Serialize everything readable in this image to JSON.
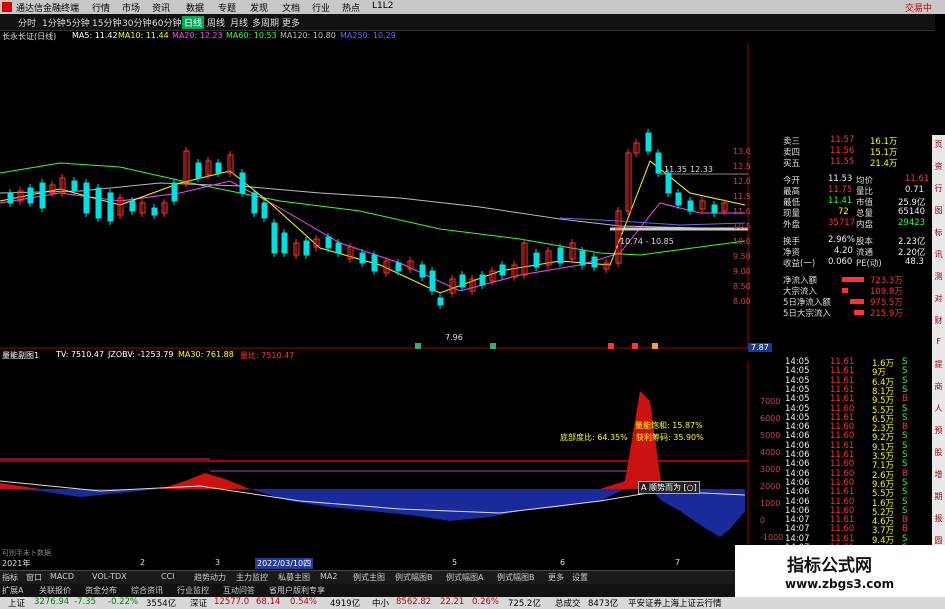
{
  "titlebar": {
    "app_name": "通达信金融终端",
    "menus": [
      "行情",
      "市场",
      "资讯",
      "数据",
      "专题",
      "发现",
      "文档",
      "行业",
      "热点",
      "L1L2"
    ],
    "right_text": "交易中"
  },
  "toolbar": {
    "periods": [
      "分时",
      "1分钟",
      "5分钟",
      "15分钟",
      "30分钟",
      "60分钟",
      "日线",
      "周线",
      "月线",
      "多周期",
      "更多"
    ],
    "active_period": "日线"
  },
  "ma_legend": {
    "stock": "长永长证(日线)",
    "items": [
      {
        "label": "MA5: 11.42",
        "color": "#ffffff"
      },
      {
        "label": "MA10: 11.44",
        "color": "#ffff00"
      },
      {
        "label": "MA20: 12.23",
        "color": "#ff44ff"
      },
      {
        "label": "MA60: 10.53",
        "color": "#33ff33"
      },
      {
        "label": "MA120: 10.80",
        "color": "#bbbbbb"
      },
      {
        "label": "MA250: 10.29",
        "color": "#6666ff"
      }
    ]
  },
  "price_axis": [
    "13.00",
    "12.50",
    "12.00",
    "11.50",
    "11.00",
    "10.50",
    "10.00",
    "9.50",
    "9.00",
    "8.50",
    "8.00"
  ],
  "annotations": {
    "high": "12.33",
    "low": "7.96",
    "mid_range": "10.74 - 10.85",
    "marker_top": "11.35",
    "last_price": "7.87"
  },
  "quote": {
    "rows": [
      {
        "l": "卖三",
        "v": "11.57",
        "n": "16.1万"
      },
      {
        "l": "卖四",
        "v": "11.56",
        "n": "15.1万"
      },
      {
        "l": "买五",
        "v": "11.55",
        "n": "21.4万"
      }
    ],
    "stats": [
      {
        "l": "今开",
        "v": "11.53",
        "l2": "均价",
        "v2": "11.61"
      },
      {
        "l": "最高",
        "v": "11.75",
        "l2": "量比",
        "v2": "0.71"
      },
      {
        "l": "最低",
        "v": "11.41",
        "l2": "市值",
        "v2": "25.9亿"
      },
      {
        "l": "现量",
        "v": "72",
        "l2": "总量",
        "v2": "65140"
      },
      {
        "l": "外盘",
        "v": "35717",
        "l2": "内盘",
        "v2": "29423"
      },
      {
        "l": "换手",
        "v": "2.96%",
        "l2": "股本",
        "v2": "2.23亿"
      },
      {
        "l": "净资",
        "v": "4.20",
        "l2": "流通",
        "v2": "2.20亿"
      },
      {
        "l": "收益(一)",
        "v": "0.060",
        "l2": "PE(动)",
        "v2": "48.3"
      }
    ],
    "flows": [
      {
        "l": "净流入额",
        "v": "723.3万"
      },
      {
        "l": "大宗流入",
        "v": "109.8万"
      },
      {
        "l": "5日净流入额",
        "v": "975.5万"
      },
      {
        "l": "5日大宗流入",
        "v": "215.9万"
      }
    ]
  },
  "ticks": [
    {
      "t": "14:05",
      "p": "11.61",
      "q": "1.6万",
      "s": "S"
    },
    {
      "t": "14:05",
      "p": "11.61",
      "q": "9万",
      "s": "S"
    },
    {
      "t": "14:05",
      "p": "11.61",
      "q": "6.4万",
      "s": "S"
    },
    {
      "t": "14:05",
      "p": "11.61",
      "q": "8.1万",
      "s": "S"
    },
    {
      "t": "14:05",
      "p": "11.61",
      "q": "9.5万",
      "s": "B"
    },
    {
      "t": "14:05",
      "p": "11.60",
      "q": "5.5万",
      "s": "S"
    },
    {
      "t": "14:05",
      "p": "11.61",
      "q": "6.5万",
      "s": "S"
    },
    {
      "t": "14:06",
      "p": "11.60",
      "q": "2.3万",
      "s": "B"
    },
    {
      "t": "14:06",
      "p": "11.60",
      "q": "9.2万",
      "s": "S"
    },
    {
      "t": "14:06",
      "p": "11.61",
      "q": "9.1万",
      "s": "S"
    },
    {
      "t": "14:06",
      "p": "11.61",
      "q": "3.5万",
      "s": "S"
    },
    {
      "t": "14:06",
      "p": "11.60",
      "q": "7.1万",
      "s": "S"
    },
    {
      "t": "14:06",
      "p": "11.60",
      "q": "2.6万",
      "s": "B"
    },
    {
      "t": "14:06",
      "p": "11.60",
      "q": "9.6万",
      "s": "S"
    },
    {
      "t": "14:06",
      "p": "11.61",
      "q": "5.5万",
      "s": "S"
    },
    {
      "t": "14:06",
      "p": "11.60",
      "q": "1.6万",
      "s": "S"
    },
    {
      "t": "14:06",
      "p": "11.60",
      "q": "5.2万",
      "s": "S"
    },
    {
      "t": "14:07",
      "p": "11.61",
      "q": "4.6万",
      "s": "B"
    },
    {
      "t": "14:07",
      "p": "11.60",
      "q": "3.7万",
      "s": "B"
    },
    {
      "t": "14:07",
      "p": "11.61",
      "q": "9.4万",
      "s": "S"
    },
    {
      "t": "14:07",
      "p": "11.61",
      "q": "2.2万",
      "s": "S"
    }
  ],
  "indicator": {
    "legend": [
      {
        "label": "量能副图1",
        "color": "#ffffff"
      },
      {
        "label": "TV: 7510.47",
        "color": "#ffffff"
      },
      {
        "label": "JZOBV: -1253.79",
        "color": "#ffffff"
      },
      {
        "label": "MA30: 761.88",
        "color": "#ffff00"
      },
      {
        "label": "量比: 7510.47",
        "color": "#ff3333"
      }
    ],
    "axis": [
      "7000",
      "6000",
      "5000",
      "4000",
      "3000",
      "2000",
      "1000",
      "0",
      "-1000"
    ],
    "labels": {
      "l1": "量能饱和:  15.87%",
      "l2": "底部度比:  64.35%",
      "l3": "获利筹码:  35.90%",
      "box": "A 顺势而为 [○]"
    },
    "forecast": "可别手未卜数据"
  },
  "timeline": {
    "labels": [
      "2021年",
      "2",
      "3",
      "2022/03/10四",
      "5",
      "6",
      "7"
    ]
  },
  "bottom_tabs": [
    "指标",
    "窗口",
    "MACD",
    "VOL-TDX",
    "CCI",
    "趋势动力",
    "主力监控",
    "私募主图",
    "MA2",
    "例式主图",
    "例式幅图B",
    "例式幅图A",
    "例式幅图B",
    "更多",
    "设置"
  ],
  "bottom_tabs2": [
    "扩展A",
    "关联报价",
    "资金分布",
    "综合资讯",
    "行业监控",
    "互动问答",
    "省用户版利专享"
  ],
  "status": {
    "items": [
      {
        "l": "上证",
        "v": "3276.94",
        "c": "-7.35",
        "p": "-0.22%",
        "a": "3554亿"
      },
      {
        "l": "深证",
        "v": "12577.0",
        "c": "68.14",
        "p": "0.54%",
        "a": "4919亿"
      },
      {
        "l": "中小",
        "v": "8562.82",
        "c": "22.21",
        "p": "0.26%",
        "a": "725.2亿"
      }
    ],
    "turnover_label": "总成交",
    "turnover": "8473亿",
    "broker": "平安证券上海上证云行情"
  },
  "watermark": {
    "title": "指标公式网",
    "url": "www.zbgs3.com"
  },
  "sidebar": [
    "页",
    "资",
    "行",
    "图",
    "标",
    "讯",
    "测",
    "对",
    "财",
    "F",
    "提",
    "商",
    "人",
    "预",
    "股",
    "增",
    "期",
    "报",
    "圆",
    "图"
  ]
}
